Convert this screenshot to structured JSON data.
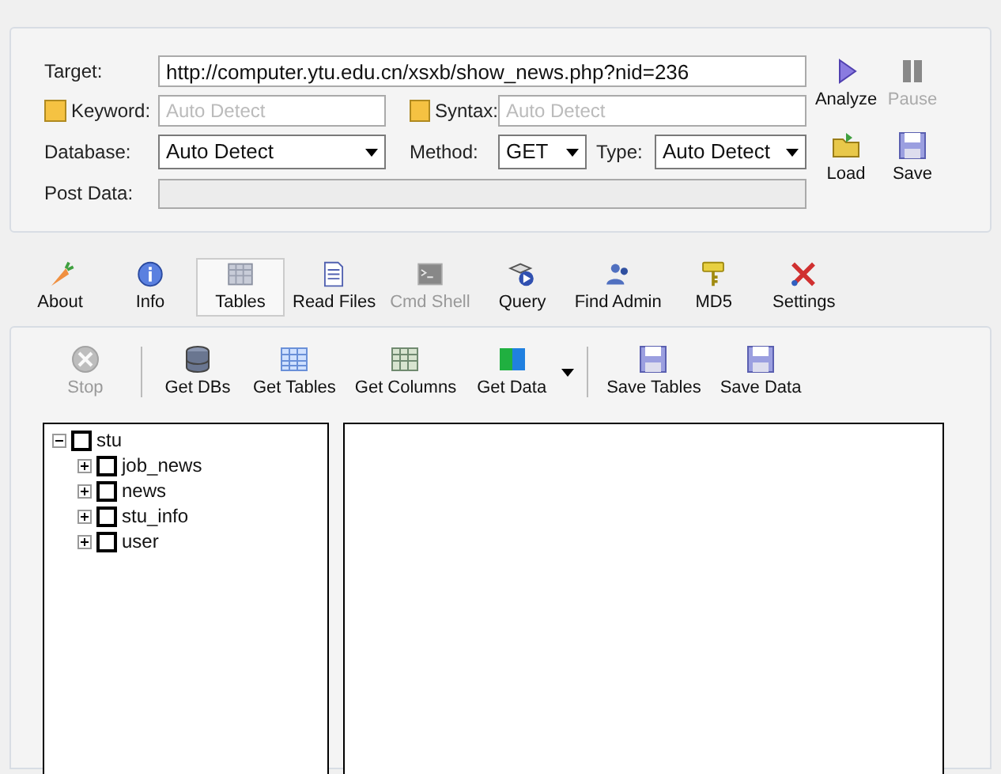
{
  "target": {
    "label": "Target:",
    "value": "http://computer.ytu.edu.cn/xsxb/show_news.php?nid=236"
  },
  "keyword": {
    "label": "Keyword:",
    "checked": false,
    "placeholder": "Auto Detect"
  },
  "syntax": {
    "label": "Syntax:",
    "checked": false,
    "placeholder": "Auto Detect"
  },
  "database": {
    "label": "Database:",
    "value": "Auto Detect"
  },
  "method": {
    "label": "Method:",
    "value": "GET"
  },
  "type": {
    "label": "Type:",
    "value": "Auto Detect"
  },
  "post_data": {
    "label": "Post Data:",
    "disabled": true
  },
  "side_buttons": [
    {
      "kind": "play",
      "label": "Analyze",
      "disabled": false
    },
    {
      "kind": "pause",
      "label": "Pause",
      "disabled": true
    },
    {
      "kind": "folder",
      "label": "Load",
      "disabled": false
    },
    {
      "kind": "disk",
      "label": "Save",
      "disabled": false
    }
  ],
  "tabs": [
    {
      "kind": "carrot",
      "label": "About",
      "selected": false,
      "disabled": false
    },
    {
      "kind": "info",
      "label": "Info",
      "selected": false,
      "disabled": false
    },
    {
      "kind": "table",
      "label": "Tables",
      "selected": true,
      "disabled": false
    },
    {
      "kind": "file",
      "label": "Read Files",
      "selected": false,
      "disabled": false
    },
    {
      "kind": "terminal",
      "label": "Cmd Shell",
      "selected": false,
      "disabled": true
    },
    {
      "kind": "query",
      "label": "Query",
      "selected": false,
      "disabled": false
    },
    {
      "kind": "users",
      "label": "Find Admin",
      "selected": false,
      "disabled": false
    },
    {
      "kind": "key",
      "label": "MD5",
      "selected": false,
      "disabled": false
    },
    {
      "kind": "tools",
      "label": "Settings",
      "selected": false,
      "disabled": false
    }
  ],
  "toolbar": [
    {
      "kind": "stop",
      "label": "Stop",
      "disabled": true
    },
    {
      "kind": "separator"
    },
    {
      "kind": "database",
      "label": "Get DBs",
      "disabled": false
    },
    {
      "kind": "grid",
      "label": "Get Tables",
      "disabled": false
    },
    {
      "kind": "columns",
      "label": "Get Columns",
      "disabled": false
    },
    {
      "kind": "data",
      "label": "Get Data",
      "disabled": false
    },
    {
      "kind": "dropdown"
    },
    {
      "kind": "separator"
    },
    {
      "kind": "disk",
      "label": "Save Tables",
      "disabled": false
    },
    {
      "kind": "disk",
      "label": "Save Data",
      "disabled": false
    }
  ],
  "tree": [
    {
      "label": "stu",
      "expanded": true,
      "checked": false,
      "children": [
        {
          "label": "job_news",
          "expanded": false,
          "checked": false
        },
        {
          "label": "news",
          "expanded": false,
          "checked": false
        },
        {
          "label": "stu_info",
          "expanded": false,
          "checked": false
        },
        {
          "label": "user",
          "expanded": false,
          "checked": false
        }
      ]
    }
  ]
}
